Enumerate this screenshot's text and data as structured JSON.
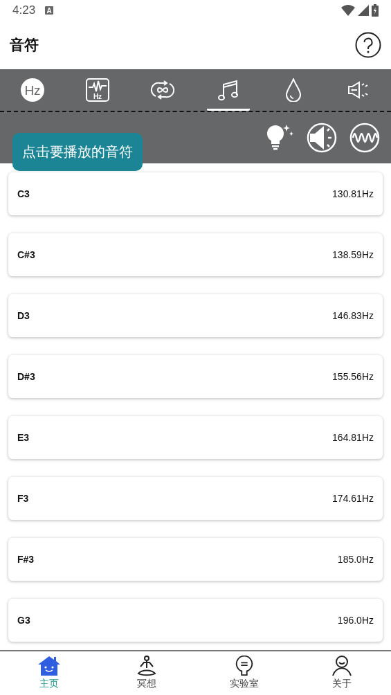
{
  "status_bar": {
    "time": "4:23",
    "badge": "A"
  },
  "header": {
    "title": "音符"
  },
  "tool_tabs": [
    {
      "kind": "hz",
      "text": "Hz",
      "selected": false
    },
    {
      "kind": "spectrum",
      "text": "Hz",
      "selected": false
    },
    {
      "kind": "loop",
      "selected": false
    },
    {
      "kind": "note",
      "selected": true
    },
    {
      "kind": "drop",
      "selected": false
    },
    {
      "kind": "speaker",
      "selected": false
    }
  ],
  "actions": [
    {
      "kind": "bulb"
    },
    {
      "kind": "volume"
    },
    {
      "kind": "wave"
    }
  ],
  "tooltip": "点击要播放的音符",
  "notes": [
    {
      "name": "C3",
      "frequency": "130.81Hz"
    },
    {
      "name": "C#3",
      "frequency": "138.59Hz"
    },
    {
      "name": "D3",
      "frequency": "146.83Hz"
    },
    {
      "name": "D#3",
      "frequency": "155.56Hz"
    },
    {
      "name": "E3",
      "frequency": "164.81Hz"
    },
    {
      "name": "F3",
      "frequency": "174.61Hz"
    },
    {
      "name": "F#3",
      "frequency": "185.0Hz"
    },
    {
      "name": "G3",
      "frequency": "196.0Hz"
    }
  ],
  "bottom_nav": [
    {
      "kind": "home",
      "label": "主页",
      "selected": true
    },
    {
      "kind": "meditate",
      "label": "冥想",
      "selected": false
    },
    {
      "kind": "lab",
      "label": "实验室",
      "selected": false
    },
    {
      "kind": "about",
      "label": "关于",
      "selected": false
    }
  ]
}
